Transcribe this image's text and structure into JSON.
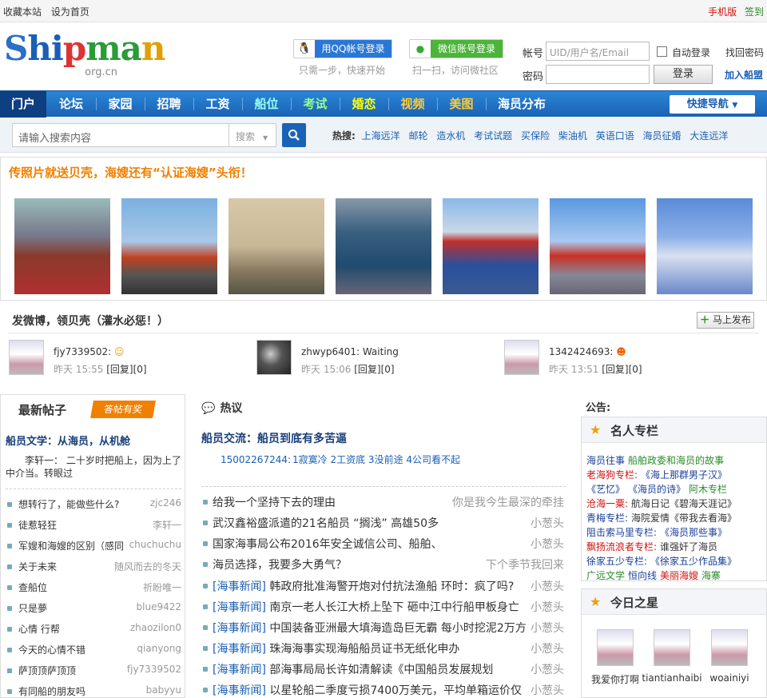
{
  "topbar": {
    "fav": "收藏本站",
    "home": "设为首页",
    "mobile": "手机版",
    "signin": "签到"
  },
  "header": {
    "logo_text": "Shipman",
    "logo_sub": "org.cn",
    "qq_btn": "用QQ帐号登录",
    "qq_sub": "只需一步，快速开始",
    "wx_btn": "微信账号登录",
    "wx_sub": "扫一扫，访问微社区",
    "acct_label": "帐号",
    "acct_placeholder": "UID/用户名/Email",
    "auto_login": "自动登录",
    "forgot": "找回密码",
    "pwd_label": "密码",
    "login_btn": "登录",
    "join": "加入船盟"
  },
  "nav": {
    "items": [
      "门户",
      "论坛",
      "家园",
      "招聘",
      "工资",
      "船位",
      "考试",
      "婚恋",
      "视频",
      "美图",
      "海员分布"
    ],
    "quick": "快捷导航"
  },
  "search": {
    "placeholder": "请输入搜索内容",
    "select": "搜索",
    "hot_label": "热搜:",
    "hot": [
      "上海远洋",
      "邮轮",
      "造水机",
      "考试试题",
      "买保险",
      "柴油机",
      "英语口语",
      "海员征婚",
      "大连远洋"
    ]
  },
  "photos": {
    "title": "传照片就送贝壳，海嫂还有“认证海嫂”头衔！"
  },
  "weibo": {
    "title": "发微博，领贝壳（灌水必惩！）",
    "btn": "马上发布",
    "posts": [
      {
        "name": "fjy7339502:",
        "time": "昨天 15:55",
        "reply": "[回复][0]"
      },
      {
        "name": "zhwyp6401: Waiting",
        "time": "昨天 15:06",
        "reply": "[回复][0]"
      },
      {
        "name": "1342424693:",
        "time": "昨天 13:51",
        "reply": "[回复][0]"
      }
    ]
  },
  "latest": {
    "title": "最新帖子",
    "tag": "答帖有奖",
    "headline": "船员文学：从海员，从机舱",
    "summary": "李轩一： 二十岁时把船上，因为上了中介当。转眼过",
    "rows": [
      {
        "t": "想转行了，能做些什么?",
        "a": "zjc246"
      },
      {
        "t": "徒惹轻狂",
        "a": "李轩一"
      },
      {
        "t": "军嫂和海嫂的区别（感同",
        "a": "chuchuchu"
      },
      {
        "t": "关于未来",
        "a": "随风而去的冬天"
      },
      {
        "t": "查船位",
        "a": "祈盼唯一"
      },
      {
        "t": "只是夢",
        "a": "blue9422"
      },
      {
        "t": "心情 行帮",
        "a": "zhaozilon0"
      },
      {
        "t": "今天的心情不错",
        "a": "qianyong"
      },
      {
        "t": "萨顶顶萨顶顶",
        "a": "fjy7339502"
      },
      {
        "t": "有同船的朋友吗",
        "a": "babyyu"
      }
    ]
  },
  "hot": {
    "title": "热议",
    "headline": "船员交流：船员到底有多苦逼",
    "summary_user": "15002267244:",
    "summary_text": "1寂寞冷 2工资底 3没前途 4公司看不起",
    "rows": [
      {
        "tag": "",
        "t": "给我一个坚持下去的理由",
        "a": "你是我今生最深的牵挂"
      },
      {
        "tag": "",
        "t": "武汉鑫裕盛派遣的21名船员 “搁浅” 高雄50多",
        "a": "小葱头"
      },
      {
        "tag": "",
        "t": "国家海事局公布2016年安全诚信公司、船舶、",
        "a": "小葱头"
      },
      {
        "tag": "",
        "t": "海员选择，我要多大勇气？",
        "a": "下个季节我回来"
      },
      {
        "tag": "[海事新闻]",
        "t": " 韩政府批准海警开炮对付抗法渔船  环时：疯了吗?",
        "a": "小葱头"
      },
      {
        "tag": "[海事新闻]",
        "t": " 南京一老人长江大桥上坠下  砸中江中行船甲板身亡",
        "a": "小葱头"
      },
      {
        "tag": "[海事新闻]",
        "t": " 中国装备亚洲最大填海造岛巨无霸  每小时挖泥2万方",
        "a": "小葱头"
      },
      {
        "tag": "[海事新闻]",
        "t": " 珠海海事实现海船船员证书无纸化申办",
        "a": "小葱头"
      },
      {
        "tag": "[海事新闻]",
        "t": " 部海事局局长许如清解读《中国船员发展规划",
        "a": "小葱头"
      },
      {
        "tag": "[海事新闻]",
        "t": " 以星轮船二季度亏损7400万美元，平均单箱运价仅",
        "a": "小葱头"
      }
    ]
  },
  "sidebar": {
    "announce": "公告:",
    "col_title": "名人专栏",
    "col_lines": [
      [
        {
          "t": "海员往事",
          "c": "#1a3f9a"
        },
        {
          "t": "船舶政委和海员的故事",
          "c": "#2a8a2a"
        }
      ],
      [
        {
          "t": "老海狗专栏:",
          "c": "#d01010"
        },
        {
          "t": "《海上那群男子汉》",
          "c": "#1a3f9a"
        }
      ],
      [
        {
          "t": "《艺忆》",
          "c": "#1a3f9a"
        },
        {
          "t": "《海员的诗》",
          "c": "#1a3f9a"
        },
        {
          "t": "阿木专栏",
          "c": "#2a8a2a"
        }
      ],
      [
        {
          "t": "沧海一粟:",
          "c": "#d01010"
        },
        {
          "t": "航海日记《碧海天涯记》",
          "c": "#333333"
        }
      ],
      [
        {
          "t": "青梅专栏:",
          "c": "#1a3f9a"
        },
        {
          "t": "海院爱情《带我去看海》",
          "c": "#333333"
        }
      ],
      [
        {
          "t": "阻击索马里专栏:",
          "c": "#1a3f9a"
        },
        {
          "t": "《海员那些事》",
          "c": "#1a3f9a"
        }
      ],
      [
        {
          "t": "飘扬流浪者专栏:",
          "c": "#d01010"
        },
        {
          "t": "谁强奸了海员",
          "c": "#333333"
        }
      ],
      [
        {
          "t": "徐家五少专栏:",
          "c": "#1a3f9a"
        },
        {
          "t": "《徐家五少作品集》",
          "c": "#1a3f9a"
        }
      ],
      [
        {
          "t": "广远文学",
          "c": "#2a8a2a"
        },
        {
          "t": "恒向线",
          "c": "#1a3f9a"
        },
        {
          "t": "美丽海嫂",
          "c": "#d01010"
        },
        {
          "t": "海寨",
          "c": "#2a8a2a"
        }
      ]
    ],
    "star_title": "今日之星",
    "stars": [
      "我爱你打啊",
      "tiantianhaibi",
      "woainiyi"
    ]
  }
}
